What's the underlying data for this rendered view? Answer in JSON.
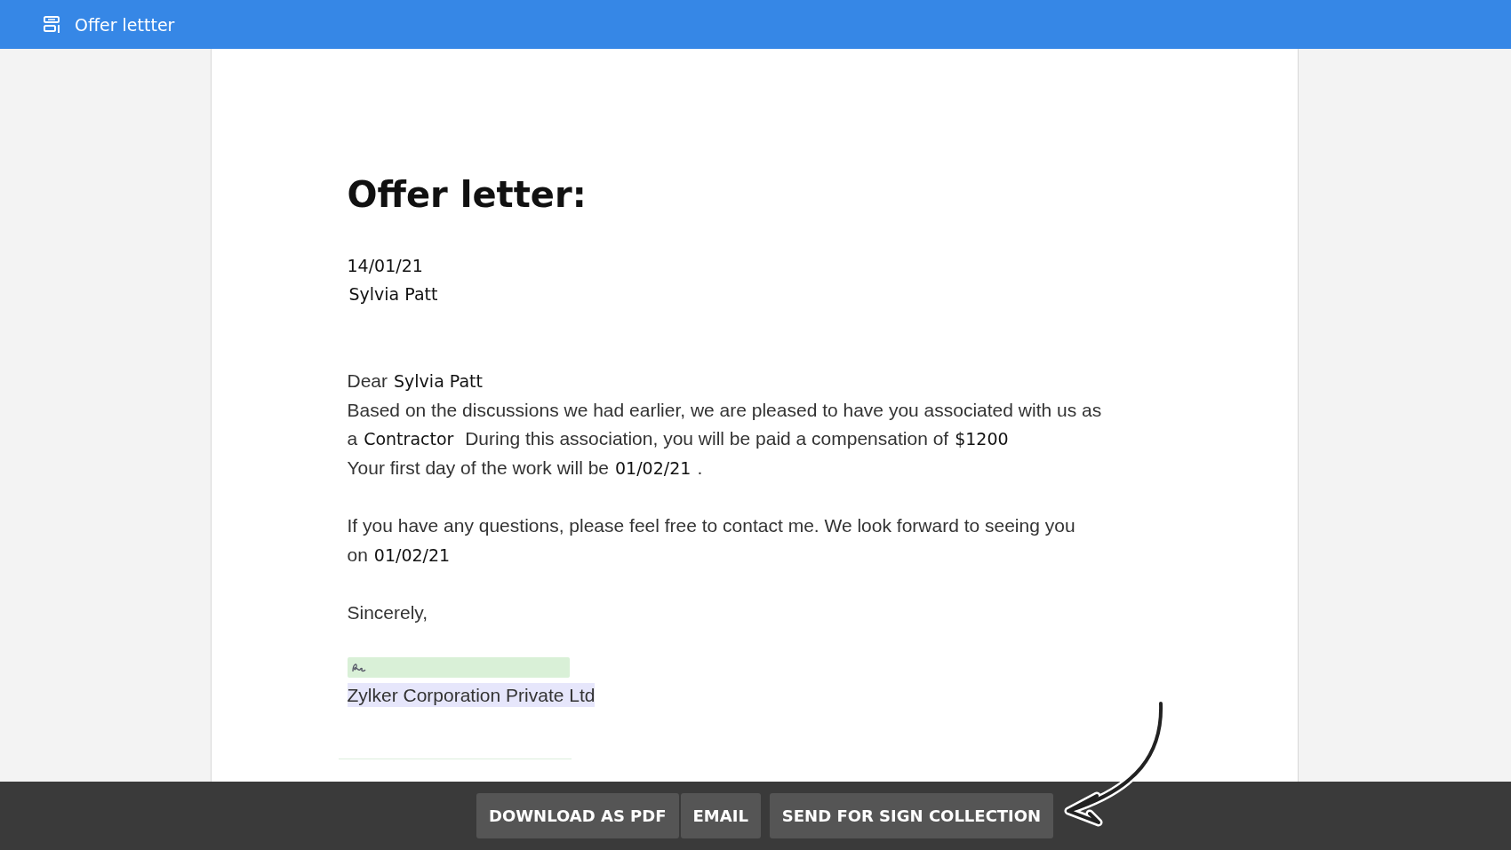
{
  "title_bar": {
    "title": "Offer lettter"
  },
  "letter": {
    "heading": "Offer letter:",
    "date": "14/01/21",
    "recipient": "Sylvia Patt",
    "blocks": [
      {
        "lines": [
          [
            {
              "kind": "text",
              "text": "Dear"
            },
            {
              "kind": "field",
              "text": "Sylvia Patt"
            }
          ],
          [
            {
              "kind": "text",
              "text": "Based on the discussions we had earlier, we are pleased to have you associated with us as a"
            },
            {
              "kind": "field",
              "text": "Contractor"
            },
            {
              "kind": "text",
              "text": " During this association, you will be paid a compensation of"
            },
            {
              "kind": "field",
              "text": "$1200"
            }
          ],
          [
            {
              "kind": "text",
              "text": "Your first day of the work will be"
            },
            {
              "kind": "field",
              "text": "01/02/21"
            },
            {
              "kind": "text",
              "text": "."
            }
          ]
        ]
      },
      {
        "lines": [
          [
            {
              "kind": "text",
              "text": "If you have any questions, please feel free to contact me. We look forward to seeing you on"
            },
            {
              "kind": "field",
              "text": "01/02/21"
            }
          ]
        ]
      },
      {
        "lines": [
          [
            {
              "kind": "text",
              "text": "Sincerely,"
            }
          ]
        ]
      }
    ],
    "company": "Zylker Corporation Private Ltd"
  },
  "actions": [
    "DOWNLOAD AS PDF",
    "EMAIL",
    "SEND FOR SIGN COLLECTION"
  ]
}
